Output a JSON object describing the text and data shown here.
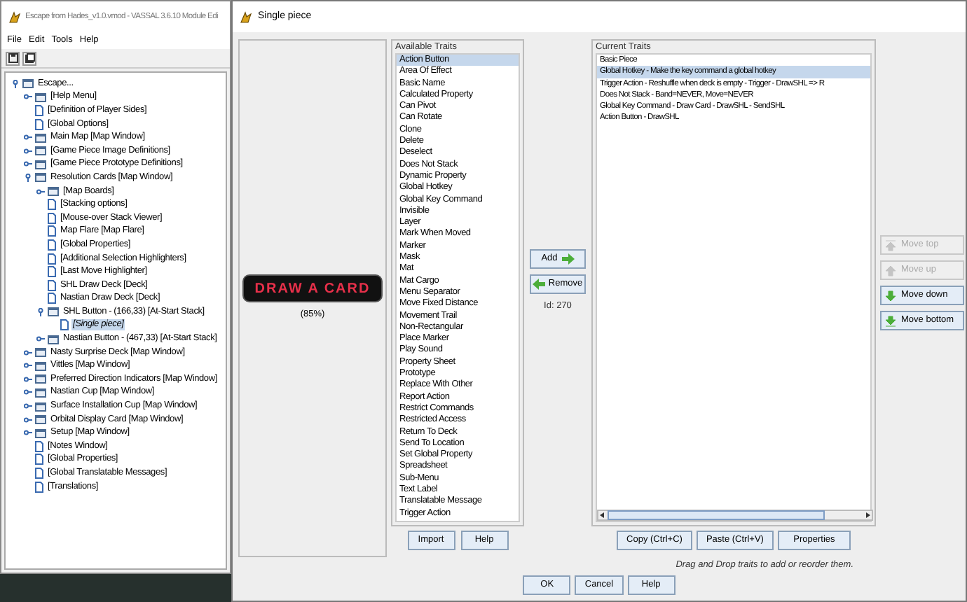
{
  "back_window": {
    "title": "Escape from Hades_v1.0.vmod - VASSAL 3.6.10 Module Edi",
    "menu": [
      "File",
      "Edit",
      "Tools",
      "Help"
    ],
    "tree": [
      {
        "label": "Escape...",
        "kind": "folder",
        "expanded": true,
        "selected": false,
        "children": [
          {
            "label": "[Help Menu]",
            "kind": "folder",
            "expanded": false,
            "selected": false
          },
          {
            "label": "[Definition of Player Sides]",
            "kind": "page",
            "selected": false
          },
          {
            "label": "[Global Options]",
            "kind": "page",
            "selected": false
          },
          {
            "label": "Main Map [Map Window]",
            "kind": "folder",
            "expanded": false,
            "selected": false
          },
          {
            "label": "[Game Piece Image Definitions]",
            "kind": "folder",
            "expanded": false,
            "selected": false
          },
          {
            "label": "[Game Piece Prototype Definitions]",
            "kind": "folder",
            "expanded": false,
            "selected": false
          },
          {
            "label": "Resolution Cards [Map Window]",
            "kind": "folder",
            "expanded": true,
            "selected": false,
            "children": [
              {
                "label": "[Map Boards]",
                "kind": "folder",
                "expanded": false,
                "selected": false
              },
              {
                "label": "[Stacking options]",
                "kind": "page",
                "selected": false
              },
              {
                "label": "[Mouse-over Stack Viewer]",
                "kind": "page",
                "selected": false
              },
              {
                "label": "Map Flare [Map Flare]",
                "kind": "page",
                "selected": false
              },
              {
                "label": "[Global Properties]",
                "kind": "page",
                "selected": false
              },
              {
                "label": "[Additional Selection Highlighters]",
                "kind": "page",
                "selected": false
              },
              {
                "label": "[Last Move Highlighter]",
                "kind": "page",
                "selected": false
              },
              {
                "label": "SHL Draw Deck [Deck]",
                "kind": "page",
                "selected": false
              },
              {
                "label": "Nastian Draw Deck [Deck]",
                "kind": "page",
                "selected": false
              },
              {
                "label": "SHL Button - (166,33) [At-Start Stack]",
                "kind": "folder",
                "expanded": true,
                "selected": false,
                "children": [
                  {
                    "label": "[Single piece]",
                    "kind": "page",
                    "selected": true
                  }
                ]
              },
              {
                "label": "Nastian Button - (467,33) [At-Start Stack]",
                "kind": "folder",
                "expanded": false,
                "selected": false
              }
            ]
          },
          {
            "label": "Nasty Surprise Deck [Map Window]",
            "kind": "folder",
            "expanded": false,
            "selected": false
          },
          {
            "label": "Vittles [Map Window]",
            "kind": "folder",
            "expanded": false,
            "selected": false
          },
          {
            "label": "Preferred Direction Indicators [Map Window]",
            "kind": "folder",
            "expanded": false,
            "selected": false
          },
          {
            "label": "Nastian Cup [Map Window]",
            "kind": "folder",
            "expanded": false,
            "selected": false
          },
          {
            "label": "Surface Installation Cup [Map Window]",
            "kind": "folder",
            "expanded": false,
            "selected": false
          },
          {
            "label": "Orbital Display Card [Map Window]",
            "kind": "folder",
            "expanded": false,
            "selected": false
          },
          {
            "label": "Setup [Map Window]",
            "kind": "folder",
            "expanded": false,
            "selected": false
          },
          {
            "label": "[Notes Window]",
            "kind": "page",
            "selected": false
          },
          {
            "label": "[Global Properties]",
            "kind": "page",
            "selected": false
          },
          {
            "label": "[Global Translatable Messages]",
            "kind": "page",
            "selected": false
          },
          {
            "label": "[Translations]",
            "kind": "page",
            "selected": false
          }
        ]
      }
    ]
  },
  "dialog": {
    "title": "Single piece",
    "preview": {
      "image_text": "DRAW A CARD",
      "zoom": "(85%)"
    },
    "available_traits": {
      "title": "Available Traits",
      "items": [
        {
          "label": "Action Button",
          "selected": true
        },
        {
          "label": "Area Of Effect",
          "selected": false
        },
        {
          "label": "Basic Name",
          "selected": false
        },
        {
          "label": "Calculated Property",
          "selected": false
        },
        {
          "label": "Can Pivot",
          "selected": false
        },
        {
          "label": "Can Rotate",
          "selected": false
        },
        {
          "label": "Clone",
          "selected": false
        },
        {
          "label": "Delete",
          "selected": false
        },
        {
          "label": "Deselect",
          "selected": false
        },
        {
          "label": "Does Not Stack",
          "selected": false
        },
        {
          "label": "Dynamic Property",
          "selected": false
        },
        {
          "label": "Global Hotkey",
          "selected": false
        },
        {
          "label": "Global Key Command",
          "selected": false
        },
        {
          "label": "Invisible",
          "selected": false
        },
        {
          "label": "Layer",
          "selected": false
        },
        {
          "label": "Mark When Moved",
          "selected": false
        },
        {
          "label": "Marker",
          "selected": false
        },
        {
          "label": "Mask",
          "selected": false
        },
        {
          "label": "Mat",
          "selected": false
        },
        {
          "label": "Mat Cargo",
          "selected": false
        },
        {
          "label": "Menu Separator",
          "selected": false
        },
        {
          "label": "Move Fixed Distance",
          "selected": false
        },
        {
          "label": "Movement Trail",
          "selected": false
        },
        {
          "label": "Non-Rectangular",
          "selected": false
        },
        {
          "label": "Place Marker",
          "selected": false
        },
        {
          "label": "Play Sound",
          "selected": false
        },
        {
          "label": "Property Sheet",
          "selected": false
        },
        {
          "label": "Prototype",
          "selected": false
        },
        {
          "label": "Replace With Other",
          "selected": false
        },
        {
          "label": "Report Action",
          "selected": false
        },
        {
          "label": "Restrict Commands",
          "selected": false
        },
        {
          "label": "Restricted Access",
          "selected": false
        },
        {
          "label": "Return To Deck",
          "selected": false
        },
        {
          "label": "Send To Location",
          "selected": false
        },
        {
          "label": "Set Global Property",
          "selected": false
        },
        {
          "label": "Spreadsheet",
          "selected": false
        },
        {
          "label": "Sub-Menu",
          "selected": false
        },
        {
          "label": "Text Label",
          "selected": false
        },
        {
          "label": "Translatable Message",
          "selected": false
        },
        {
          "label": "Trigger Action",
          "selected": false
        }
      ]
    },
    "add_button": "Add",
    "remove_button": "Remove",
    "id_label": "Id: 270",
    "current_traits": {
      "title": "Current Traits",
      "items": [
        {
          "label": "Basic Piece",
          "selected": false
        },
        {
          "label": "Global Hotkey - Make the key command a global hotkey",
          "selected": true
        },
        {
          "label": "Trigger Action - Reshuffle when deck is empty - Trigger - DrawSHL => R",
          "selected": false
        },
        {
          "label": "Does Not Stack - Band=NEVER, Move=NEVER",
          "selected": false
        },
        {
          "label": "Global Key Command - Draw Card - DrawSHL - SendSHL",
          "selected": false
        },
        {
          "label": "Action Button - DrawSHL",
          "selected": false
        }
      ]
    },
    "move_buttons": [
      {
        "label": "Move top",
        "kind": "top",
        "disabled": true
      },
      {
        "label": "Move up",
        "kind": "up",
        "disabled": true
      },
      {
        "label": "Move down",
        "kind": "down",
        "disabled": false
      },
      {
        "label": "Move bottom",
        "kind": "bottom",
        "disabled": false
      }
    ],
    "available_buttons": [
      "Import",
      "Help"
    ],
    "current_buttons": [
      "Copy (Ctrl+C)",
      "Paste (Ctrl+V)",
      "Properties"
    ],
    "hint": "Drag and Drop traits to add or reorder them.",
    "footer_buttons": [
      "OK",
      "Cancel",
      "Help"
    ]
  }
}
